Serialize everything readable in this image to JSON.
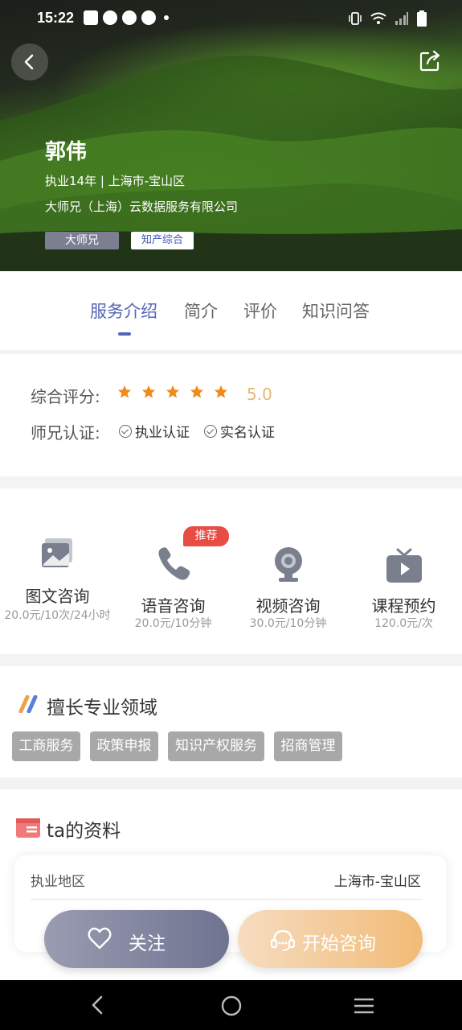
{
  "status_bar": {
    "time": "15:22"
  },
  "profile_header": {
    "name": "郭伟",
    "experience": "执业14年 | 上海市-宝山区",
    "company": "大师兄（上海）云数据服务有限公司",
    "tag_primary": "大师兄",
    "tag_secondary": "知产综合"
  },
  "tabs": [
    {
      "label": "服务介绍",
      "active": true
    },
    {
      "label": "简介"
    },
    {
      "label": "评价"
    },
    {
      "label": "知识问答"
    }
  ],
  "rating": {
    "label": "综合评分:",
    "stars": 5,
    "score": "5.0",
    "cert_label": "师兄认证:",
    "certs": [
      "执业认证",
      "实名认证"
    ]
  },
  "services": [
    {
      "name": "图文咨询",
      "price": "20.0元/10次/24小时",
      "icon": "image-chat-icon"
    },
    {
      "name": "语音咨询",
      "price": "20.0元/10分钟",
      "icon": "phone-icon",
      "badge": "推荐"
    },
    {
      "name": "视频咨询",
      "price": "30.0元/10分钟",
      "icon": "webcam-icon"
    },
    {
      "name": "课程预约",
      "price": "120.0元/次",
      "icon": "tv-play-icon"
    }
  ],
  "expertise": {
    "title": "擅长专业领域",
    "chips": [
      "工商服务",
      "政策申报",
      "知识产权服务",
      "招商管理"
    ]
  },
  "profile_info": {
    "title": "ta的资料",
    "rows": [
      {
        "label": "执业地区",
        "value": "上海市-宝山区"
      }
    ]
  },
  "actions": {
    "follow": "关注",
    "consult": "开始咨询"
  },
  "colors": {
    "accent": "#5566b8",
    "star": "#f08a1c",
    "badge": "#e84c43",
    "consult_btn": "#f1bb76"
  }
}
